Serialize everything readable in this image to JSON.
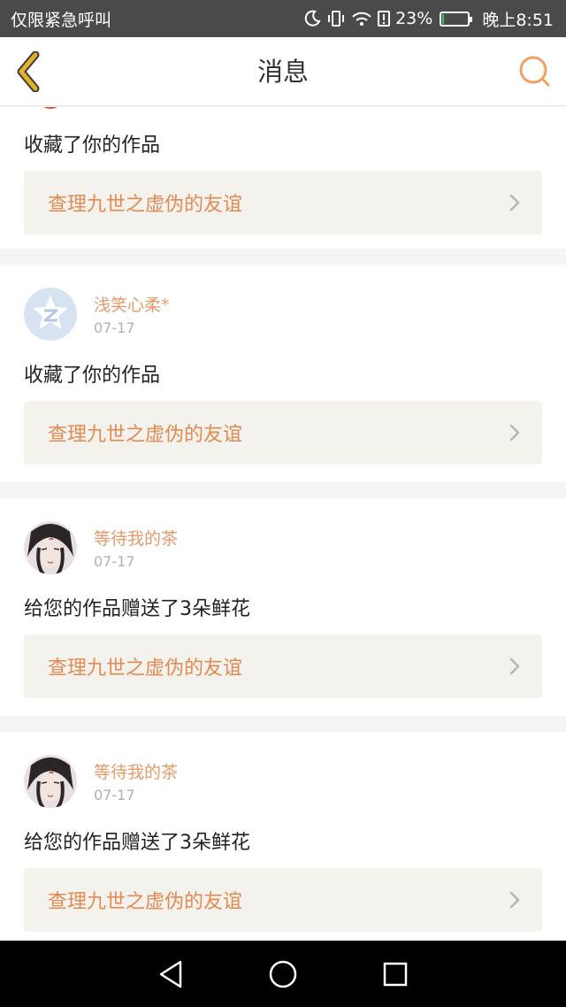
{
  "status_bar": {
    "carrier": "仅限紧急呼叫",
    "battery_percent": "23%",
    "time": "晚上8:51",
    "battery_level": 0.23,
    "icons": [
      "moon-icon",
      "vibrate-icon",
      "wifi-icon",
      "alert-icon",
      "battery-icon"
    ]
  },
  "header": {
    "title": "消息",
    "accent": "#e2a02a",
    "search_color": "#f0a060"
  },
  "colors": {
    "username": "#e59a6a",
    "link_title": "#e38b55",
    "link_bg": "#f3f2ec"
  },
  "messages": [
    {
      "action": "收藏了你的作品",
      "work_title": "查理九世之虚伪的友谊"
    },
    {
      "username": "浅笑心柔*",
      "date": "07-17",
      "action": "收藏了你的作品",
      "work_title": "查理九世之虚伪的友谊",
      "avatar": "qq-default-avatar"
    },
    {
      "username": "等待我的茶",
      "date": "07-17",
      "action": "给您的作品赠送了3朵鲜花",
      "work_title": "查理九世之虚伪的友谊",
      "avatar": "character-avatar"
    },
    {
      "username": "等待我的茶",
      "date": "07-17",
      "action": "给您的作品赠送了3朵鲜花",
      "work_title": "查理九世之虚伪的友谊",
      "avatar": "character-avatar"
    }
  ],
  "nav_bar": {
    "buttons": [
      "back-triangle-icon",
      "home-circle-icon",
      "recents-square-icon"
    ]
  }
}
